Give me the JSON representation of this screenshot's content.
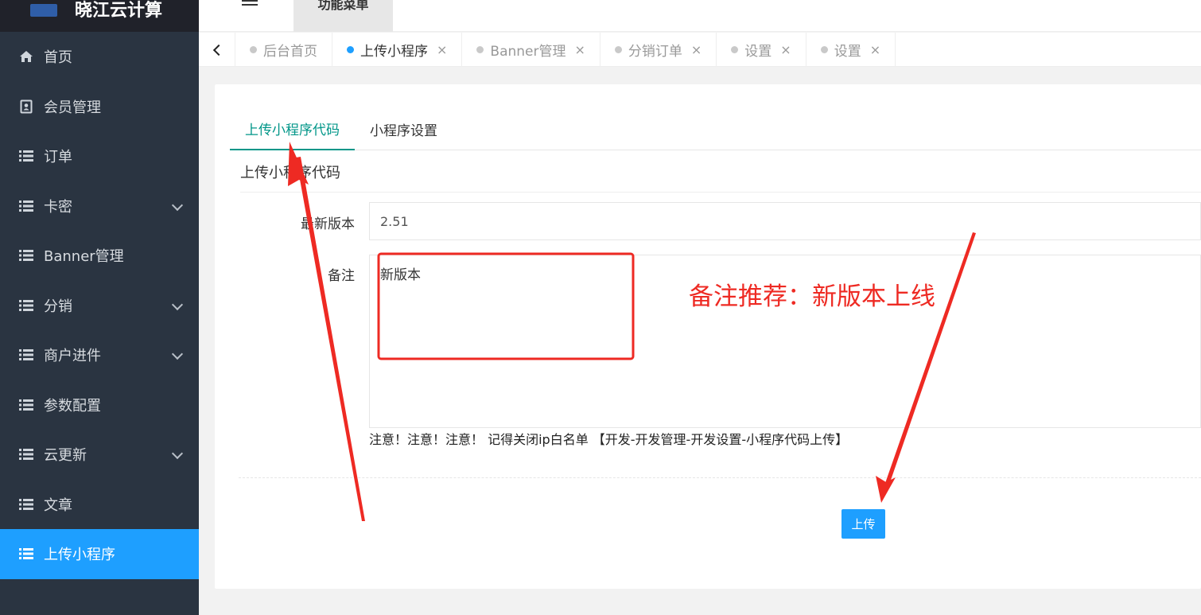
{
  "app": {
    "logo_text": "晓江云计算",
    "top_menu_label": "功能菜单"
  },
  "sidebar": {
    "items": [
      {
        "label": "首页",
        "icon": "home-icon",
        "expandable": false,
        "active": false
      },
      {
        "label": "会员管理",
        "icon": "member-card-icon",
        "expandable": false,
        "active": false
      },
      {
        "label": "订单",
        "icon": "list-icon",
        "expandable": false,
        "active": false
      },
      {
        "label": "卡密",
        "icon": "list-icon",
        "expandable": true,
        "active": false
      },
      {
        "label": "Banner管理",
        "icon": "list-icon",
        "expandable": false,
        "active": false
      },
      {
        "label": "分销",
        "icon": "list-icon",
        "expandable": true,
        "active": false
      },
      {
        "label": "商户进件",
        "icon": "list-icon",
        "expandable": true,
        "active": false
      },
      {
        "label": "参数配置",
        "icon": "list-icon",
        "expandable": false,
        "active": false
      },
      {
        "label": "云更新",
        "icon": "list-icon",
        "expandable": true,
        "active": false
      },
      {
        "label": "文章",
        "icon": "list-icon",
        "expandable": false,
        "active": false
      },
      {
        "label": "上传小程序",
        "icon": "list-icon",
        "expandable": false,
        "active": true
      }
    ]
  },
  "tabs": [
    {
      "label": "后台首页",
      "closable": false,
      "active": false
    },
    {
      "label": "上传小程序",
      "closable": true,
      "active": true
    },
    {
      "label": "Banner管理",
      "closable": true,
      "active": false
    },
    {
      "label": "分销订单",
      "closable": true,
      "active": false
    },
    {
      "label": "设置",
      "closable": true,
      "active": false
    },
    {
      "label": "设置",
      "closable": true,
      "active": false
    }
  ],
  "tab_close_glyph": "×",
  "content": {
    "sub_tabs": [
      "上传小程序代码",
      "小程序设置"
    ],
    "section_title": "上传小程序代码",
    "version_label": "最新版本",
    "version_value": "2.51",
    "note_label": "备注",
    "note_value": "新版本",
    "hint": "注意！注意！注意！ 记得关闭ip白名单 【开发-开发管理-开发设置-小程序代码上传】",
    "upload_button": "上传"
  },
  "annotation": {
    "text": "备注推荐：新版本上线",
    "color": "#ee2a23"
  },
  "colors": {
    "sidebar_bg": "#2a3441",
    "active_blue": "#1e9fff",
    "tab_green": "#009688"
  }
}
